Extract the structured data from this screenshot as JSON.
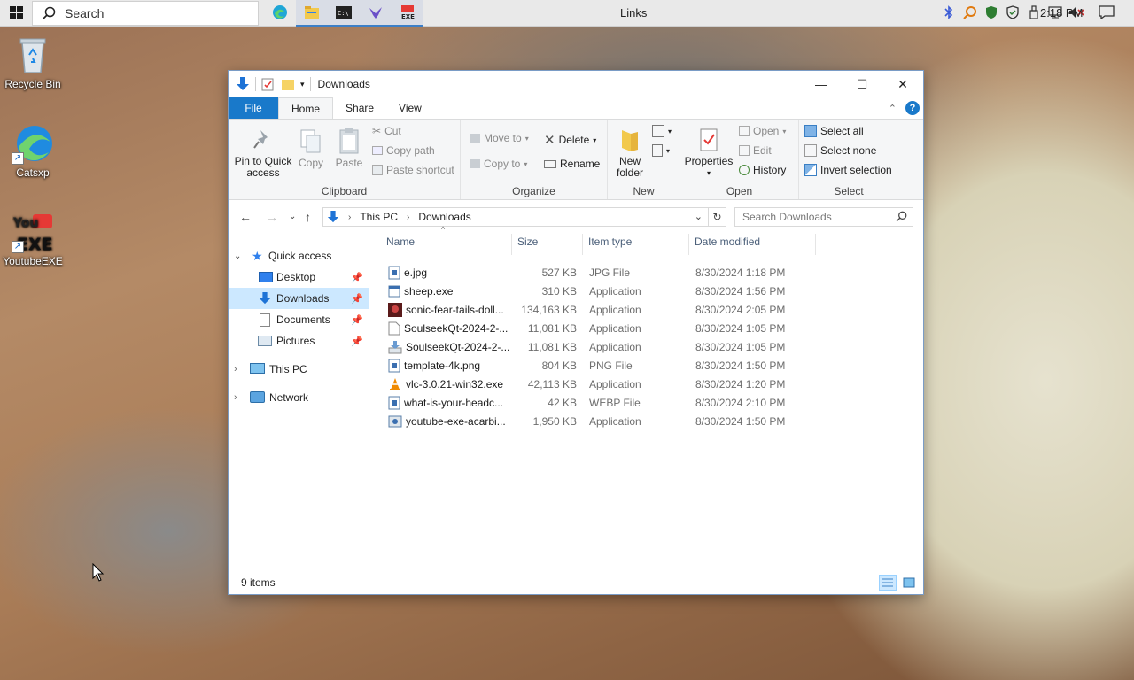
{
  "taskbar": {
    "search_placeholder": "Search",
    "center_title": "Links",
    "clock": "2:18 PM",
    "apps": [
      "edge-icon",
      "file-explorer-icon",
      "terminal-icon",
      "bird-app-icon",
      "exe-app-icon"
    ]
  },
  "desktop": {
    "icons": [
      {
        "label": "Recycle Bin"
      },
      {
        "label": "Catsxp"
      },
      {
        "label": "YoutubeEXE"
      }
    ]
  },
  "window": {
    "title": "Downloads",
    "tabs": [
      "File",
      "Home",
      "Share",
      "View"
    ],
    "active_tab": "Home",
    "ribbon": {
      "clipboard": {
        "label": "Clipboard",
        "pin": "Pin to Quick access",
        "copy": "Copy",
        "paste": "Paste",
        "cut": "Cut",
        "copy_path": "Copy path",
        "paste_shortcut": "Paste shortcut"
      },
      "organize": {
        "label": "Organize",
        "move_to": "Move to",
        "copy_to": "Copy to",
        "delete": "Delete",
        "rename": "Rename"
      },
      "new": {
        "label": "New",
        "new_folder": "New folder"
      },
      "open": {
        "label": "Open",
        "properties": "Properties",
        "open": "Open",
        "edit": "Edit",
        "history": "History"
      },
      "select": {
        "label": "Select",
        "select_all": "Select all",
        "select_none": "Select none",
        "invert": "Invert selection"
      }
    },
    "address": {
      "segments": [
        "This PC",
        "Downloads"
      ],
      "search_placeholder": "Search Downloads"
    },
    "nav": {
      "quick_access": "Quick access",
      "desktop": "Desktop",
      "downloads": "Downloads",
      "documents": "Documents",
      "pictures": "Pictures",
      "this_pc": "This PC",
      "network": "Network"
    },
    "columns": {
      "name": "Name",
      "size": "Size",
      "type": "Item type",
      "date": "Date modified"
    },
    "files": [
      {
        "name": "e.jpg",
        "size": "527 KB",
        "type": "JPG File",
        "date": "8/30/2024 1:18 PM",
        "icon": "image-file-icon"
      },
      {
        "name": "sheep.exe",
        "size": "310 KB",
        "type": "Application",
        "date": "8/30/2024 1:56 PM",
        "icon": "exe-file-icon"
      },
      {
        "name": "sonic-fear-tails-doll...",
        "size": "134,163 KB",
        "type": "Application",
        "date": "8/30/2024 2:05 PM",
        "icon": "game-app-icon"
      },
      {
        "name": "SoulseekQt-2024-2-...",
        "size": "11,081 KB",
        "type": "Application",
        "date": "8/30/2024 1:05 PM",
        "icon": "blank-file-icon"
      },
      {
        "name": "SoulseekQt-2024-2-...",
        "size": "11,081 KB",
        "type": "Application",
        "date": "8/30/2024 1:05 PM",
        "icon": "installer-icon"
      },
      {
        "name": "template-4k.png",
        "size": "804 KB",
        "type": "PNG File",
        "date": "8/30/2024 1:50 PM",
        "icon": "image-file-icon"
      },
      {
        "name": "vlc-3.0.21-win32.exe",
        "size": "42,113 KB",
        "type": "Application",
        "date": "8/30/2024 1:20 PM",
        "icon": "vlc-cone-icon"
      },
      {
        "name": "what-is-your-headc...",
        "size": "42 KB",
        "type": "WEBP File",
        "date": "8/30/2024 2:10 PM",
        "icon": "image-file-icon"
      },
      {
        "name": "youtube-exe-acarbi...",
        "size": "1,950 KB",
        "type": "Application",
        "date": "8/30/2024 1:50 PM",
        "icon": "setup-app-icon"
      }
    ],
    "status": "9 items"
  }
}
